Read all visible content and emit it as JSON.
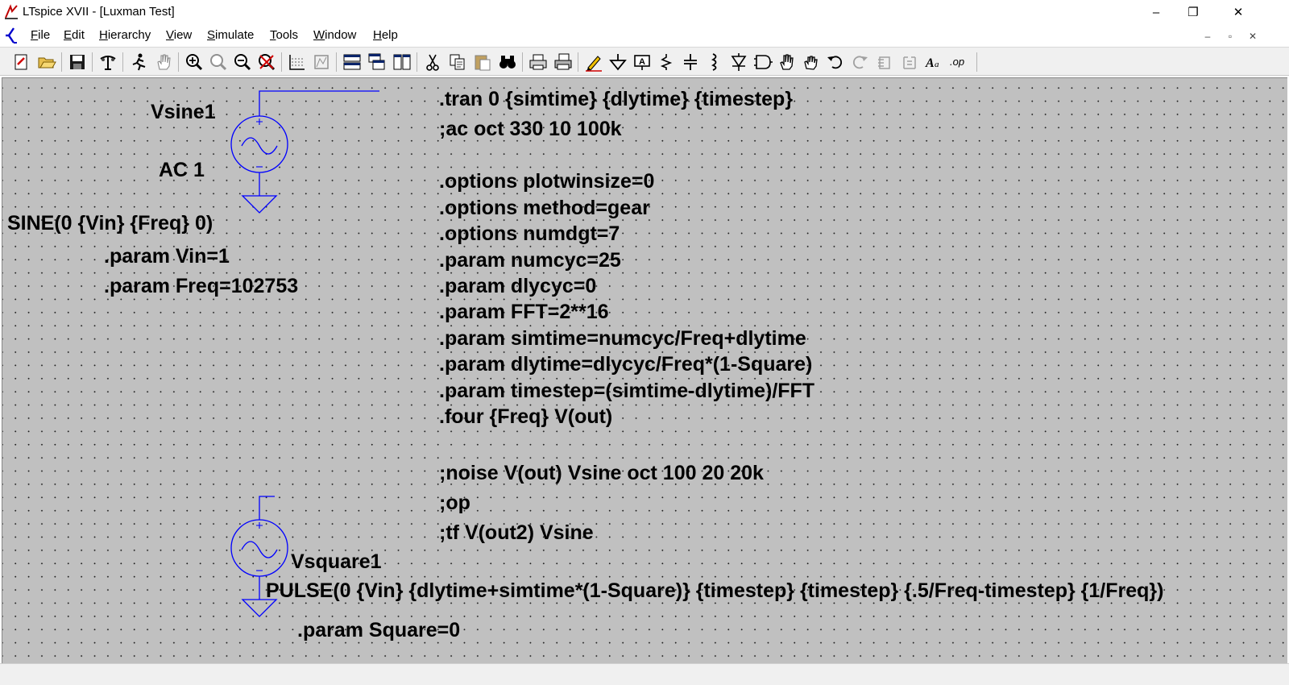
{
  "window": {
    "title": "LTspice XVII - [Luxman Test]",
    "controls": {
      "minimize": "–",
      "restore": "❐",
      "close": "✕"
    }
  },
  "menu": {
    "items": [
      {
        "label": "File",
        "accel": "F",
        "rest": "ile"
      },
      {
        "label": "Edit",
        "accel": "E",
        "rest": "dit"
      },
      {
        "label": "Hierarchy",
        "accel": "H",
        "rest": "ierarchy"
      },
      {
        "label": "View",
        "accel": "V",
        "rest": "iew"
      },
      {
        "label": "Simulate",
        "accel": "S",
        "rest": "imulate"
      },
      {
        "label": "Tools",
        "accel": "T",
        "rest": "ools"
      },
      {
        "label": "Window",
        "accel": "W",
        "rest": "indow"
      },
      {
        "label": "Help",
        "accel": "H",
        "rest": "elp"
      }
    ],
    "mdi_controls": {
      "minimize": "–",
      "restore": "▫",
      "close": "✕"
    }
  },
  "toolbar": {
    "icons": [
      "new-schematic-icon",
      "open-icon",
      "save-icon",
      "control-panel-icon",
      "run-icon",
      "halt-icon",
      "zoom-in-icon",
      "zoom-area-icon",
      "zoom-out-icon",
      "zoom-cancel-icon",
      "autorange-icon",
      "fft-icon",
      "tile-horizontal-icon",
      "cascade-icon",
      "tile-vertical-icon",
      "cut-icon",
      "copy-icon",
      "paste-icon",
      "find-icon",
      "print-setup-icon",
      "print-icon",
      "draw-wire-icon",
      "ground-icon",
      "label-net-icon",
      "resistor-icon",
      "capacitor-icon",
      "inductor-icon",
      "diode-icon",
      "component-icon",
      "move-icon",
      "drag-icon",
      "undo-icon",
      "redo-icon",
      "rotate-icon",
      "mirror-icon",
      "text-icon",
      "spice-directive-icon"
    ]
  },
  "schematic": {
    "vsine": {
      "name": "Vsine1",
      "ac": "AC 1",
      "value": "SINE(0 {Vin} {Freq} 0)",
      "params": [
        ".param Vin=1",
        ".param Freq=102753"
      ]
    },
    "vsquare": {
      "name": "Vsquare1",
      "value": "PULSE(0 {Vin} {dlytime+simtime*(1-Square)} {timestep} {timestep} {.5/Freq-timestep} {1/Freq})",
      "params": [
        ".param Square=0"
      ]
    },
    "directives_group1": [
      ".tran 0 {simtime} {dlytime} {timestep}",
      ";ac oct 330 10 100k"
    ],
    "directives_group2": [
      ".options plotwinsize=0",
      ".options method=gear",
      ".options numdgt=7",
      ".param numcyc=25",
      ".param dlycyc=0",
      ".param FFT=2**16",
      ".param simtime=numcyc/Freq+dlytime",
      ".param dlytime=dlycyc/Freq*(1-Square)",
      ".param timestep=(simtime-dlytime)/FFT",
      ".four {Freq} V(out)"
    ],
    "directives_group3": [
      ";noise V(out) Vsine oct 100 20 20k",
      ";op",
      ";tf V(out2) Vsine"
    ],
    "colors": {
      "canvas": "#c0c0c0",
      "wire": "#0000ff",
      "text": "#000000"
    }
  }
}
